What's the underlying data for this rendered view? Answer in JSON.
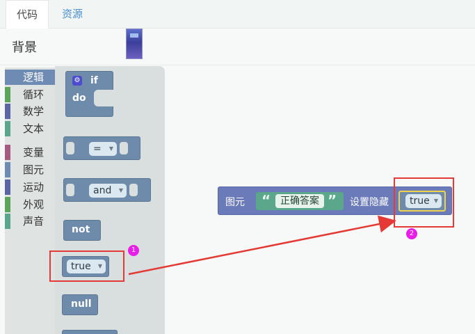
{
  "tabs": {
    "code": "代码",
    "assets": "资源"
  },
  "header": {
    "title": "背景"
  },
  "categories": [
    {
      "label": "逻辑",
      "color": "#6e8bb3"
    },
    {
      "label": "循环",
      "color": "#5ba55b"
    },
    {
      "label": "数学",
      "color": "#5b67a5"
    },
    {
      "label": "文本",
      "color": "#5ba58c"
    },
    {
      "label": "变量",
      "color": "#a55b80"
    },
    {
      "label": "图元",
      "color": "#6e8bb3"
    },
    {
      "label": "运动",
      "color": "#5b67a5"
    },
    {
      "label": "外观",
      "color": "#5ba55b"
    },
    {
      "label": "声音",
      "color": "#5ba58c"
    }
  ],
  "flyout": {
    "if_label": "if",
    "do_label": "do",
    "compare_op": "=",
    "logic_op": "and",
    "not_label": "not",
    "bool_value": "true",
    "null_label": "null"
  },
  "workspace": {
    "sprite_label": "图元",
    "string_value": "正确答案",
    "action_label": "设置隐藏",
    "bool_value": "true"
  },
  "annotations": {
    "badge1": "1",
    "badge2": "2"
  }
}
